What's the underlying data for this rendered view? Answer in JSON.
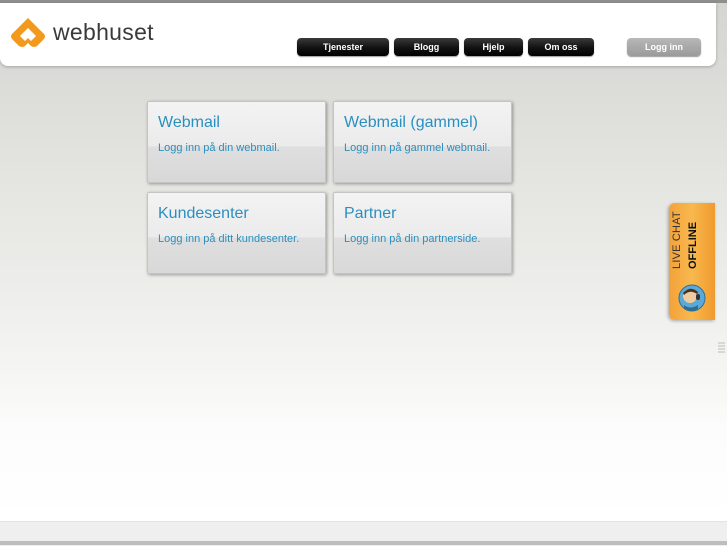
{
  "brand": {
    "name": "webhuset",
    "accent": "#f39a1e"
  },
  "nav": {
    "items": [
      {
        "label": "Tjenester"
      },
      {
        "label": "Blogg"
      },
      {
        "label": "Hjelp"
      },
      {
        "label": "Om oss"
      }
    ],
    "login_label": "Logg inn"
  },
  "cards": [
    {
      "title": "Webmail",
      "description": "Logg inn på din webmail."
    },
    {
      "title": "Webmail (gammel)",
      "description": "Logg inn på gammel webmail."
    },
    {
      "title": "Kundesenter",
      "description": "Logg inn på ditt kundesenter."
    },
    {
      "title": "Partner",
      "description": "Logg inn på din partnerside."
    }
  ],
  "livechat": {
    "line1": "LIVE CHAT",
    "line2": "OFFLINE",
    "icon": "chat-agent-icon"
  },
  "colors": {
    "link": "#2a8fbf",
    "livechat": "#f5a83e"
  }
}
